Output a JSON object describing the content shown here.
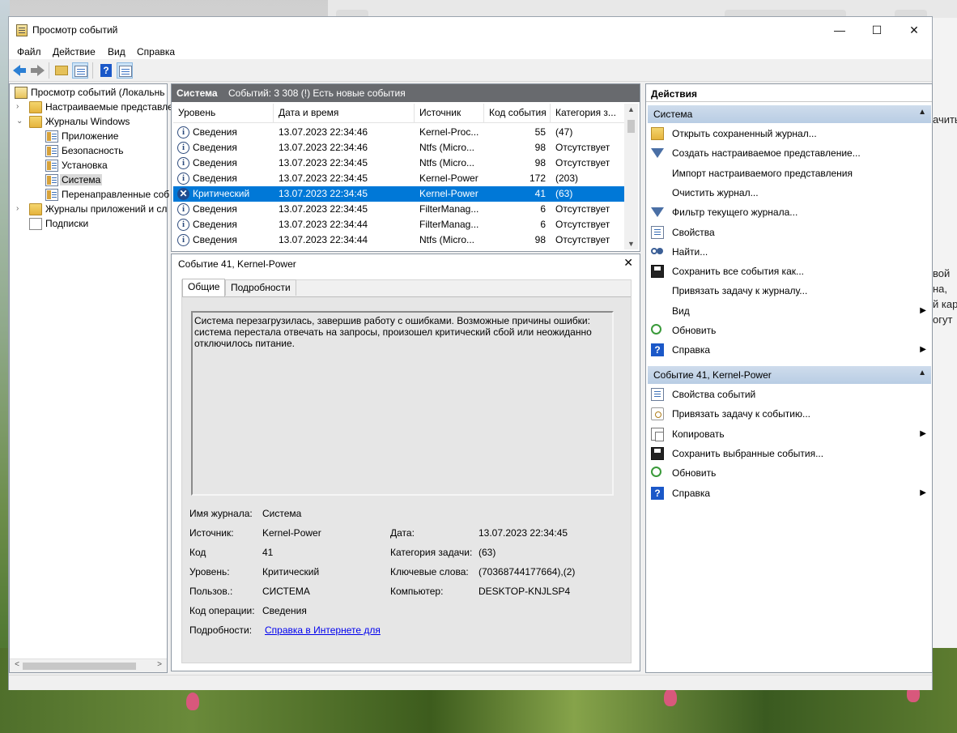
{
  "window": {
    "title": "Просмотр событий",
    "controls": {
      "minimize": "—",
      "maximize": "☐",
      "close": "✕"
    }
  },
  "menu": [
    "Файл",
    "Действие",
    "Вид",
    "Справка"
  ],
  "toolbar": {
    "icons": [
      "back-arrow-icon",
      "forward-arrow-icon",
      "folder-up-icon",
      "show-hide-tree-icon",
      "help-icon",
      "show-hide-actions-icon"
    ]
  },
  "tree": {
    "items": [
      {
        "label": "Просмотр событий (Локальнь",
        "indent": 0,
        "expander": "",
        "icon": "viewer"
      },
      {
        "label": "Настраиваемые представле",
        "indent": 1,
        "expander": ">",
        "icon": "folder"
      },
      {
        "label": "Журналы Windows",
        "indent": 1,
        "expander": "v",
        "icon": "folder"
      },
      {
        "label": "Приложение",
        "indent": 2,
        "expander": "",
        "icon": "log"
      },
      {
        "label": "Безопасность",
        "indent": 2,
        "expander": "",
        "icon": "log"
      },
      {
        "label": "Установка",
        "indent": 2,
        "expander": "",
        "icon": "log"
      },
      {
        "label": "Система",
        "indent": 2,
        "expander": "",
        "icon": "log",
        "selected": true
      },
      {
        "label": "Перенаправленные соб",
        "indent": 2,
        "expander": "",
        "icon": "log"
      },
      {
        "label": "Журналы приложений и сл",
        "indent": 1,
        "expander": ">",
        "icon": "folder"
      },
      {
        "label": "Подписки",
        "indent": 1,
        "expander": "",
        "icon": "sub"
      }
    ]
  },
  "events": {
    "header_title": "Система",
    "header_info": "Событий: 3 308 (!) Есть новые события",
    "columns": [
      "Уровень",
      "Дата и время",
      "Источник",
      "Код события",
      "Категория з..."
    ],
    "rows": [
      {
        "level": "Сведения",
        "datetime": "13.07.2023 22:34:46",
        "source": "Kernel-Proc...",
        "id": "55",
        "category": "(47)",
        "critical": false
      },
      {
        "level": "Сведения",
        "datetime": "13.07.2023 22:34:46",
        "source": "Ntfs (Micro...",
        "id": "98",
        "category": "Отсутствует",
        "critical": false
      },
      {
        "level": "Сведения",
        "datetime": "13.07.2023 22:34:45",
        "source": "Ntfs (Micro...",
        "id": "98",
        "category": "Отсутствует",
        "critical": false
      },
      {
        "level": "Сведения",
        "datetime": "13.07.2023 22:34:45",
        "source": "Kernel-Power",
        "id": "172",
        "category": "(203)",
        "critical": false
      },
      {
        "level": "Критический",
        "datetime": "13.07.2023 22:34:45",
        "source": "Kernel-Power",
        "id": "41",
        "category": "(63)",
        "critical": true,
        "selected": true
      },
      {
        "level": "Сведения",
        "datetime": "13.07.2023 22:34:45",
        "source": "FilterManag...",
        "id": "6",
        "category": "Отсутствует",
        "critical": false
      },
      {
        "level": "Сведения",
        "datetime": "13.07.2023 22:34:44",
        "source": "FilterManag...",
        "id": "6",
        "category": "Отсутствует",
        "critical": false
      },
      {
        "level": "Сведения",
        "datetime": "13.07.2023 22:34:44",
        "source": "Ntfs (Micro...",
        "id": "98",
        "category": "Отсутствует",
        "critical": false
      }
    ]
  },
  "detail": {
    "title": "Событие 41, Kernel-Power",
    "close": "✕",
    "tabs": [
      "Общие",
      "Подробности"
    ],
    "description": "Система перезагрузилась, завершив работу с ошибками. Возможные причины ошибки: система перестала отвечать на запросы, произошел критический сбой или неожиданно отключилось питание.",
    "props": {
      "log_name_label": "Имя журнала:",
      "log_name": "Система",
      "source_label": "Источник:",
      "source": "Kernel-Power",
      "date_label": "Дата:",
      "date": "13.07.2023 22:34:45",
      "code_label": "Код",
      "code": "41",
      "task_category_label": "Категория задачи:",
      "task_category": "(63)",
      "level_label": "Уровень:",
      "level": "Критический",
      "keywords_label": "Ключевые слова:",
      "keywords": "(70368744177664),(2)",
      "user_label": "Пользов.:",
      "user": "СИСТЕМА",
      "computer_label": "Компьютер:",
      "computer": "DESKTOP-KNJLSP4",
      "opcode_label": "Код операции:",
      "opcode": "Сведения",
      "more_info_label": "Подробности:",
      "more_info_link": "Справка в Интернете для"
    }
  },
  "actions": {
    "title": "Действия",
    "section1": "Система",
    "section1_items": [
      {
        "label": "Открыть сохраненный журнал...",
        "icon": "open-log-icon"
      },
      {
        "label": "Создать настраиваемое представление...",
        "icon": "create-view-icon"
      },
      {
        "label": "Импорт настраиваемого представления",
        "icon": ""
      },
      {
        "label": "Очистить журнал...",
        "icon": ""
      },
      {
        "label": "Фильтр текущего журнала...",
        "icon": "filter-icon"
      },
      {
        "label": "Свойства",
        "icon": "properties-icon"
      },
      {
        "label": "Найти...",
        "icon": "find-icon"
      },
      {
        "label": "Сохранить все события как...",
        "icon": "save-icon"
      },
      {
        "label": "Привязать задачу к журналу...",
        "icon": ""
      },
      {
        "label": "Вид",
        "icon": "",
        "submenu": true
      },
      {
        "label": "Обновить",
        "icon": "refresh-icon"
      },
      {
        "label": "Справка",
        "icon": "help-icon",
        "submenu": true
      }
    ],
    "section2": "Событие 41, Kernel-Power",
    "section2_items": [
      {
        "label": "Свойства событий",
        "icon": "event-properties-icon"
      },
      {
        "label": "Привязать задачу к событию...",
        "icon": "attach-task-icon"
      },
      {
        "label": "Копировать",
        "icon": "copy-icon",
        "submenu": true
      },
      {
        "label": "Сохранить выбранные события...",
        "icon": "save-icon"
      },
      {
        "label": "Обновить",
        "icon": "refresh-icon"
      },
      {
        "label": "Справка",
        "icon": "help-icon",
        "submenu": true
      }
    ]
  },
  "background_window": {
    "text_lines": [
      "ачить",
      "вой",
      "на,",
      "й кар",
      "огут"
    ]
  }
}
